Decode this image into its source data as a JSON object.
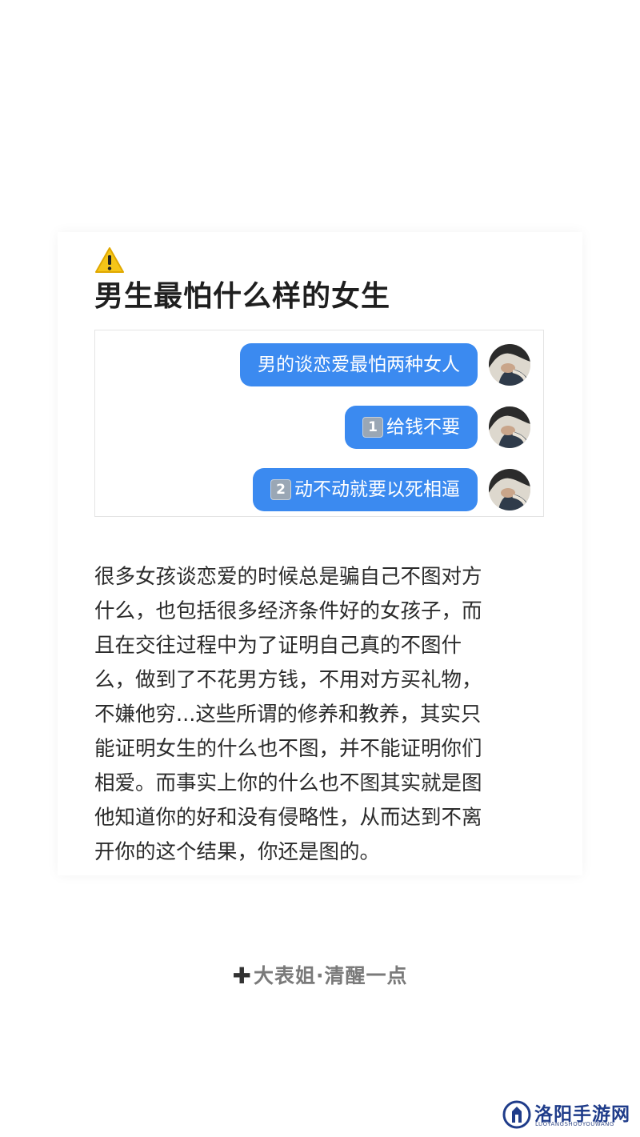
{
  "post": {
    "title": "男生最怕什么样的女生",
    "chat": {
      "messages": [
        {
          "number": "",
          "text": "男的谈恋爱最怕两种女人"
        },
        {
          "number": "1",
          "text": "给钱不要"
        },
        {
          "number": "2",
          "text": "动不动就要以死相逼"
        }
      ]
    },
    "body_lines": [
      "很多女孩谈恋爱的时候总是骗自己不图对方",
      "什么，也包括很多经济条件好的女孩子，而",
      "且在交往过程中为了证明自己真的不图什",
      "么，做到了不花男方钱，不用对方买礼物，",
      "不嫌他穷...这些所谓的修养和教养，其实只",
      "能证明女生的什么也不图，并不能证明你们",
      "相爱。而事实上你的什么也不图其实就是图",
      "他知道你的好和没有侵略性，从而达到不离",
      "开你的这个结果，你还是图的。"
    ],
    "signature": "大表姐·清醒一点"
  },
  "watermark": {
    "name": "洛阳手游网",
    "sub": "LUOYANGSHOUYOUWANG"
  },
  "colors": {
    "bubble": "#3b8af0",
    "warning": "#f5c518",
    "watermark": "#1f3c8a"
  },
  "icons": {
    "warning": "warning-icon",
    "plus": "plus-icon",
    "avatar": "avatar"
  }
}
